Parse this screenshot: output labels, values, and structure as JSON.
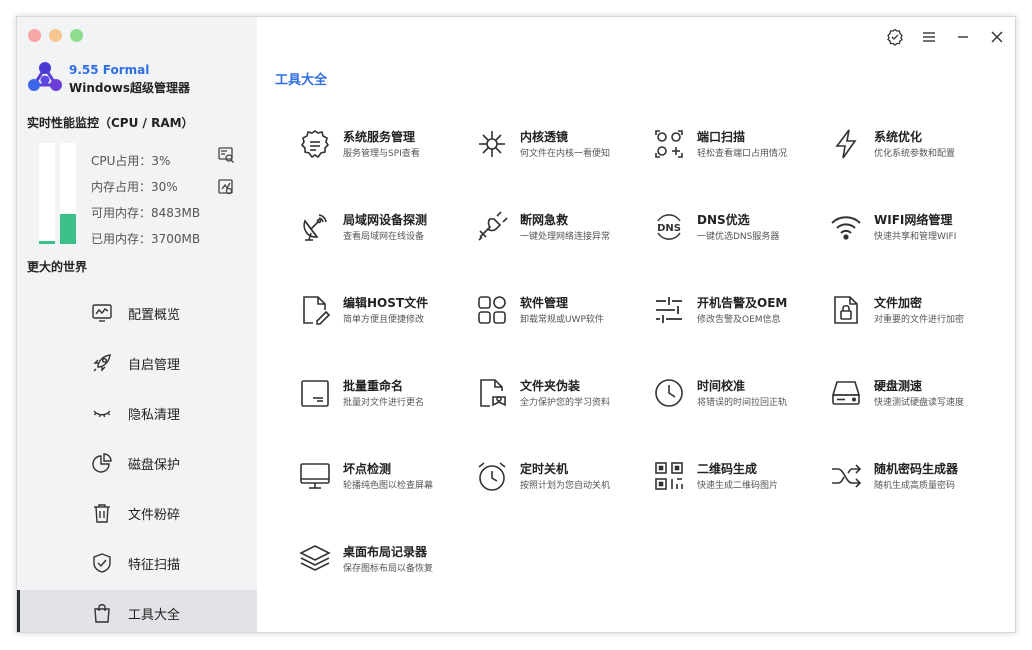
{
  "app": {
    "version": "9.55 Formal",
    "name": "Windows超级管理器"
  },
  "colors": {
    "accent": "#2f6fe4",
    "bar_fill": "#3cc08a",
    "close_dot": "#f6a6a5",
    "min_dot": "#f5c78e",
    "max_dot": "#8fdc8f"
  },
  "monitor": {
    "title": "实时性能监控（CPU / RAM）",
    "cpu_usage_pct": 3,
    "mem_usage_pct": 30,
    "stats": {
      "cpu": "CPU占用：3%",
      "mem": "内存占用：30%",
      "avail": "可用内存：8483MB",
      "used": "已用内存：3700MB"
    },
    "icons": [
      "search-report-icon",
      "memory-report-icon"
    ]
  },
  "tagline": "更大的世界",
  "nav": [
    {
      "label": "配置概览",
      "icon": "monitor-chart-icon"
    },
    {
      "label": "自启管理",
      "icon": "rocket-icon"
    },
    {
      "label": "隐私清理",
      "icon": "closed-eye-icon"
    },
    {
      "label": "磁盘保护",
      "icon": "pie-chart-icon"
    },
    {
      "label": "文件粉碎",
      "icon": "trash-icon"
    },
    {
      "label": "特征扫描",
      "icon": "shield-check-icon"
    },
    {
      "label": "工具大全",
      "icon": "bag-icon",
      "active": true
    }
  ],
  "window_controls": [
    "settings-badge-icon",
    "menu-icon",
    "minimize-icon",
    "close-icon"
  ],
  "page_title": "工具大全",
  "tools": [
    {
      "title": "系统服务管理",
      "desc": "服务管理与SPI查看",
      "icon": "gear-service-icon"
    },
    {
      "title": "内核透镜",
      "desc": "何文件在内核一看便知",
      "icon": "virus-icon"
    },
    {
      "title": "端口扫描",
      "desc": "轻松查看端口占用情况",
      "icon": "port-scan-icon"
    },
    {
      "title": "系统优化",
      "desc": "优化系统参数和配置",
      "icon": "lightning-icon"
    },
    {
      "title": "局域网设备探测",
      "desc": "查看局域网在线设备",
      "icon": "satellite-dish-icon"
    },
    {
      "title": "断网急救",
      "desc": "一键处理网络连接异常",
      "icon": "plug-icon"
    },
    {
      "title": "DNS优选",
      "desc": "一键优选DNS服务器",
      "icon": "dns-icon"
    },
    {
      "title": "WIFI网络管理",
      "desc": "快速共享和管理WIFI",
      "icon": "wifi-icon"
    },
    {
      "title": "编辑HOST文件",
      "desc": "简单方便且便捷修改",
      "icon": "file-edit-icon"
    },
    {
      "title": "软件管理",
      "desc": "卸载常规或UWP软件",
      "icon": "apps-grid-icon"
    },
    {
      "title": "开机告警及OEM",
      "desc": "修改告警及OEM信息",
      "icon": "sliders-icon"
    },
    {
      "title": "文件加密",
      "desc": "对重要的文件进行加密",
      "icon": "file-lock-icon"
    },
    {
      "title": "批量重命名",
      "desc": "批量对文件进行更名",
      "icon": "rename-icon"
    },
    {
      "title": "文件夹伪装",
      "desc": "全力保护您的学习资料",
      "icon": "file-disguise-icon"
    },
    {
      "title": "时间校准",
      "desc": "将错误的时间拉回正轨",
      "icon": "clock-icon"
    },
    {
      "title": "硬盘测速",
      "desc": "快速测试硬盘读写速度",
      "icon": "hard-drive-icon"
    },
    {
      "title": "坏点检测",
      "desc": "轮播纯色图以检查屏幕",
      "icon": "display-icon"
    },
    {
      "title": "定时关机",
      "desc": "按照计划为您自动关机",
      "icon": "alarm-clock-icon"
    },
    {
      "title": "二维码生成",
      "desc": "快速生成二维码图片",
      "icon": "qr-code-icon"
    },
    {
      "title": "随机密码生成器",
      "desc": "随机生成高质量密码",
      "icon": "shuffle-icon"
    },
    {
      "title": "桌面布局记录器",
      "desc": "保存图标布局以备恢复",
      "icon": "layers-icon"
    }
  ]
}
